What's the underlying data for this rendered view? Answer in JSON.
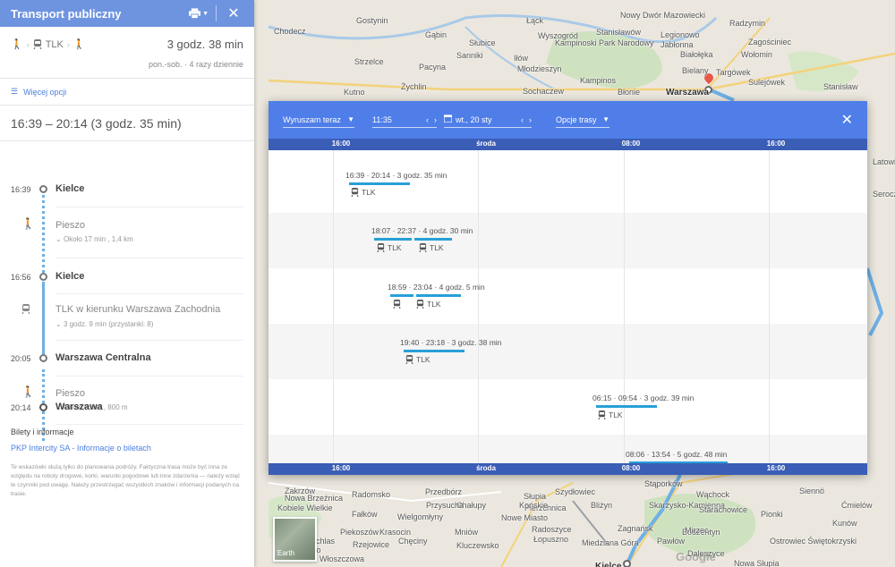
{
  "panel": {
    "title": "Transport publiczny",
    "summary": {
      "mode_train": "TLK",
      "duration": "3 godz. 38 min",
      "schedule": "pon.-sob. · 4 razy dziennie"
    },
    "more_options": "Więcej opcji",
    "trip_title": "16:39 – 20:14 (3 godz. 35 min)",
    "steps": [
      {
        "time": "16:39",
        "place": "Kielce"
      },
      {
        "title": "Pieszo",
        "detail": "Około 17 min , 1,4 km"
      },
      {
        "time": "16:56",
        "place": "Kielce"
      },
      {
        "title": "TLK w kierunku Warszawa Zachodnia",
        "detail": "3 godz. 9 min (przystanki: 8)"
      },
      {
        "time": "20:05",
        "place": "Warszawa Centralna"
      },
      {
        "title": "Pieszo",
        "detail": "Około 9 min , 800 m"
      },
      {
        "time": "20:14",
        "place": "Warszawa"
      }
    ],
    "tickets_heading": "Bilety i informacje",
    "tickets_link": "PKP Intercity SA - Informacje o biletach",
    "disclaimer": "Te wskazówki służą tylko do planowania podróży. Faktyczna trasa może być inna ze względu na roboty drogowe, korki, warunki pogodowe lub inne zdarzenia — należy wziąć te czynniki pod uwagę. Należy przestrzegać wszystkich znaków i informacji podanych na trasie."
  },
  "modal": {
    "depart_label": "Wyruszam teraz",
    "time_value": "11:35",
    "date_value": "wt., 20 sty",
    "route_options": "Opcje trasy",
    "axis_labels": [
      "16:00",
      "środa",
      "08:00",
      "16:00"
    ],
    "trips": [
      {
        "label": "16:39 · 20:14 · 3 godz. 35 min",
        "modes": [
          "TLK"
        ]
      },
      {
        "label": "18:07 · 22:37 · 4 godz. 30 min",
        "modes": [
          "TLK",
          "TLK"
        ]
      },
      {
        "label": "18:59 · 23:04 · 4 godz. 5 min",
        "modes": [
          "",
          "TLK"
        ]
      },
      {
        "label": "19:40 · 23:18 · 3 godz. 38 min",
        "modes": [
          "TLK"
        ]
      },
      {
        "label": "06:15 · 09:54 · 3 godz. 39 min",
        "modes": [
          "TLK"
        ]
      },
      {
        "label": "08:06 · 13:54 · 5 godz. 48 min",
        "modes": []
      }
    ]
  },
  "map": {
    "labels": [
      "Gostynin",
      "Gąbin",
      "Łąck",
      "Wyszogród",
      "Nowy Dwór Mazowiecki",
      "Legionowo",
      "Radzymin",
      "Chodecz",
      "Słubice",
      "Kampinoski Park Narodowy",
      "Stanisławów",
      "Jabłonna",
      "Białołęka",
      "Zagościniec",
      "Sanniki",
      "Iłów",
      "Młodzieszyn",
      "Wołomin",
      "Strzelce",
      "Pacyna",
      "Kampinos",
      "Bielany",
      "Targówek",
      "Sulejówek",
      "Żychlin",
      "Sochaczew",
      "Warszawa",
      "Kutno",
      "Błonie",
      "Stanisław",
      "Latowicz",
      "Seroczyn",
      "Zakrzów",
      "Nowa Brzeźnica",
      "Radomsko",
      "Przedbórz",
      "Chęciny",
      "Piekoszów",
      "Skarżysko-Kamienna",
      "Wąchock",
      "Siennö",
      "Kobiele Wielkie",
      "Wielgomłyny",
      "Słupia",
      "Starachowice",
      "Pawonków",
      "Fałków",
      "Pierzchnica",
      "Kluczewsko",
      "Łopuszno",
      "Zagnańsk",
      "Pawłów",
      "Ostrowiec Świętokrzyski",
      "Rzejowice",
      "Krasocin",
      "Miedziana Góra",
      "Bodzentyn",
      "Kielce",
      "Nowa Słupia",
      "Daleszyce",
      "Mniów",
      "Chałupy",
      "Radoszyce",
      "Bliżyn",
      "Mirzec",
      "Kunów",
      "Wierzchlas",
      "Żytno",
      "Włoszczowa",
      "Nowe Miasto",
      "Pionki",
      "Ćmielów",
      "Przysucha",
      "Szydłowiec",
      "Końskie",
      "Stąporków"
    ],
    "earth_label": "Earth",
    "google_logo": "Google"
  }
}
